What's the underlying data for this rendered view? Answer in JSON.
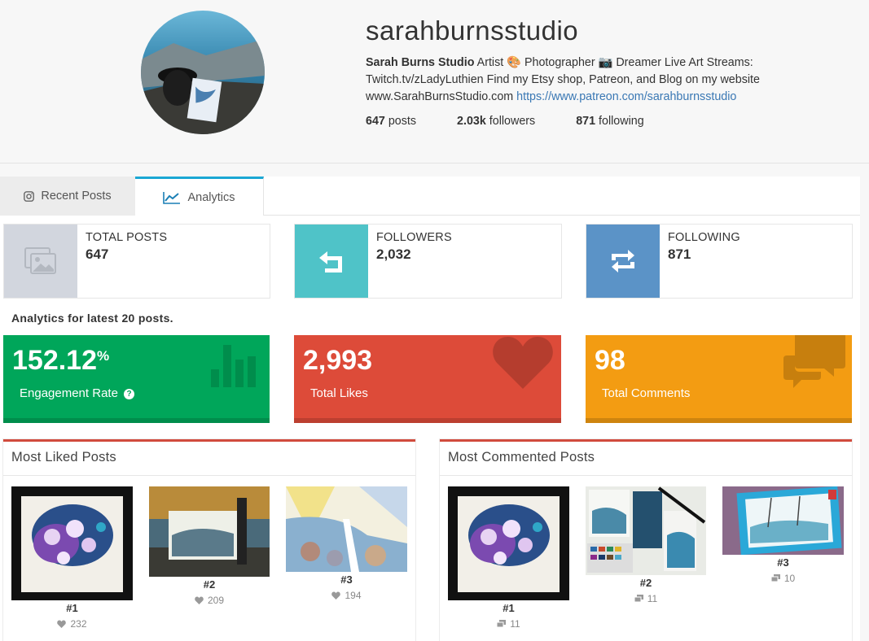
{
  "profile": {
    "username": "sarahburnsstudio",
    "bio_name": "Sarah Burns Studio",
    "bio_line1_rest": " Artist 🎨 Photographer 📷 Dreamer Live Art Streams:",
    "bio_line2": "Twitch.tv/zLadyLuthien Find my Etsy shop, Patreon, and Blog on my website",
    "bio_line3": "www.SarahBurnsStudio.com ",
    "bio_link": "https://www.patreon.com/sarahburnsstudio",
    "posts_count": "647",
    "posts_label": " posts",
    "followers_count": "2.03k",
    "followers_label": " followers",
    "following_count": "871",
    "following_label": " following"
  },
  "tabs": {
    "recent": "Recent Posts",
    "analytics": "Analytics"
  },
  "stat_boxes": {
    "total_posts_label": "TOTAL POSTS",
    "total_posts_value": "647",
    "followers_label": "FOLLOWERS",
    "followers_value": "2,032",
    "following_label": "FOLLOWING",
    "following_value": "871"
  },
  "analytics_caption": "Analytics for latest 20 posts.",
  "metrics": {
    "engagement_value": "152.12",
    "engagement_unit": "%",
    "engagement_label": "Engagement Rate",
    "likes_value": "2,993",
    "likes_label": "Total Likes",
    "comments_value": "98",
    "comments_label": "Total Comments"
  },
  "most_liked": {
    "title": "Most Liked Posts",
    "posts": [
      {
        "rank": "#1",
        "count": "232"
      },
      {
        "rank": "#2",
        "count": "209"
      },
      {
        "rank": "#3",
        "count": "194"
      }
    ]
  },
  "most_commented": {
    "title": "Most Commented Posts",
    "posts": [
      {
        "rank": "#1",
        "count": "11"
      },
      {
        "rank": "#2",
        "count": "11"
      },
      {
        "rank": "#3",
        "count": "10"
      }
    ]
  },
  "colors": {
    "accent_tab": "#1aa7d4",
    "engagement": "#00a65a",
    "likes": "#dd4b39",
    "comments": "#f39c12",
    "followers_square": "#4fc3c8",
    "following_square": "#5b93c7",
    "posts_square": "#d2d6de",
    "link": "#3a78b4"
  },
  "icons": {
    "tab_recent": "instagram-icon",
    "tab_analytics": "line-chart-icon",
    "total_posts": "images-icon",
    "followers": "reply-arrow-icon",
    "following": "retweet-icon",
    "engagement": "bar-chart-icon",
    "likes": "heart-icon",
    "comments": "comments-icon",
    "like_count": "heart-icon",
    "comment_count": "comment-icon"
  }
}
